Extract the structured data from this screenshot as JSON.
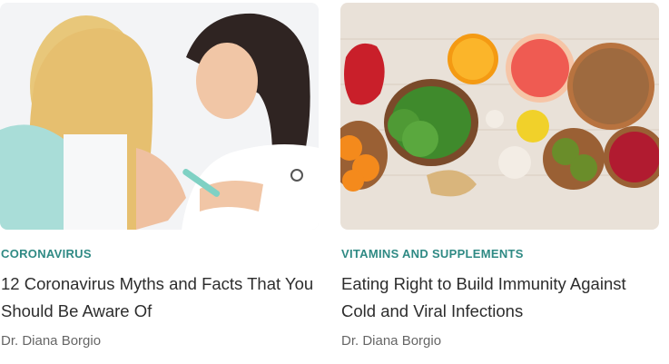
{
  "articles": [
    {
      "category": "CORONAVIRUS",
      "title": "12 Coronavirus Myths and Facts That You Should Be Aware Of",
      "author": "Dr. Diana Borgio"
    },
    {
      "category": "VITAMINS AND SUPPLEMENTS",
      "title": "Eating Right to Build Immunity Against Cold and Viral Infections",
      "author": "Dr. Diana Borgio"
    }
  ],
  "colors": {
    "category": "#2f8a84",
    "title": "#2d2d2d",
    "author": "#666666"
  }
}
